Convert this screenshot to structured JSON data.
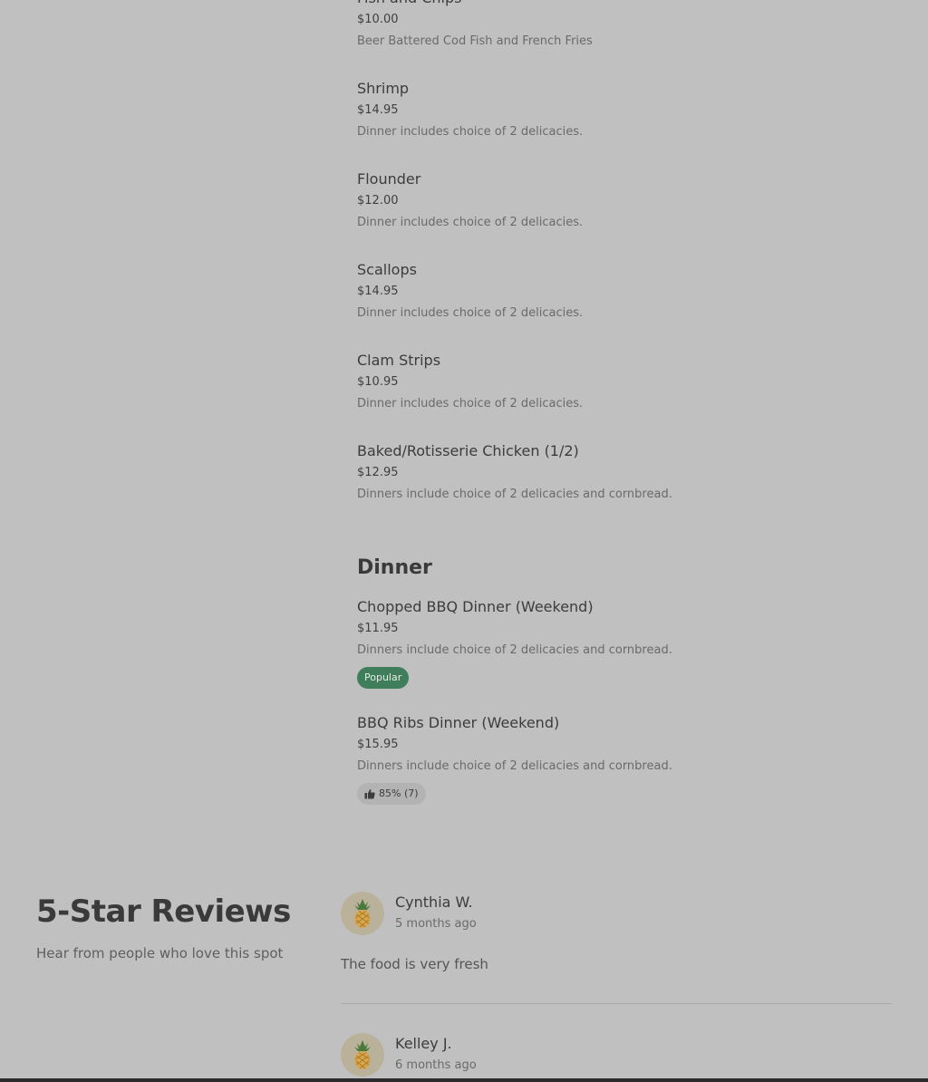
{
  "menu": {
    "items_top": [
      {
        "name": "Fish and Chips",
        "price": "$10.00",
        "desc": "Beer Battered Cod Fish and French Fries"
      },
      {
        "name": "Shrimp",
        "price": "$14.95",
        "desc": "Dinner includes choice of 2 delicacies."
      },
      {
        "name": "Flounder",
        "price": "$12.00",
        "desc": "Dinner includes choice of 2 delicacies."
      },
      {
        "name": "Scallops",
        "price": "$14.95",
        "desc": "Dinner includes choice of 2 delicacies."
      },
      {
        "name": "Clam Strips",
        "price": "$10.95",
        "desc": "Dinner includes choice of 2 delicacies."
      },
      {
        "name": "Baked/Rotisserie Chicken (1/2)",
        "price": "$12.95",
        "desc": "Dinners include choice of 2 delicacies and cornbread."
      }
    ],
    "dinner_section": {
      "title": "Dinner",
      "items": [
        {
          "name": "Chopped BBQ Dinner (Weekend)",
          "price": "$11.95",
          "desc": "Dinners include choice of 2 delicacies and cornbread.",
          "badge": "Popular"
        },
        {
          "name": "BBQ Ribs Dinner (Weekend)",
          "price": "$15.95",
          "desc": "Dinners include choice of 2 delicacies and cornbread.",
          "rating": "85% (7)"
        }
      ]
    }
  },
  "reviews": {
    "heading": "5-Star Reviews",
    "subheading": "Hear from people who love this spot",
    "list": [
      {
        "name": "Cynthia W.",
        "time": "5 months ago",
        "text": "The food is very fresh"
      },
      {
        "name": "Kelley J.",
        "time": "6 months ago"
      }
    ]
  },
  "colors": {
    "background": "#c0c0c0",
    "popular_badge": "#3f7d5b",
    "avatar_bg": "#b9b19a"
  },
  "icons": [
    "thumbs-up-icon",
    "pineapple-icon"
  ]
}
